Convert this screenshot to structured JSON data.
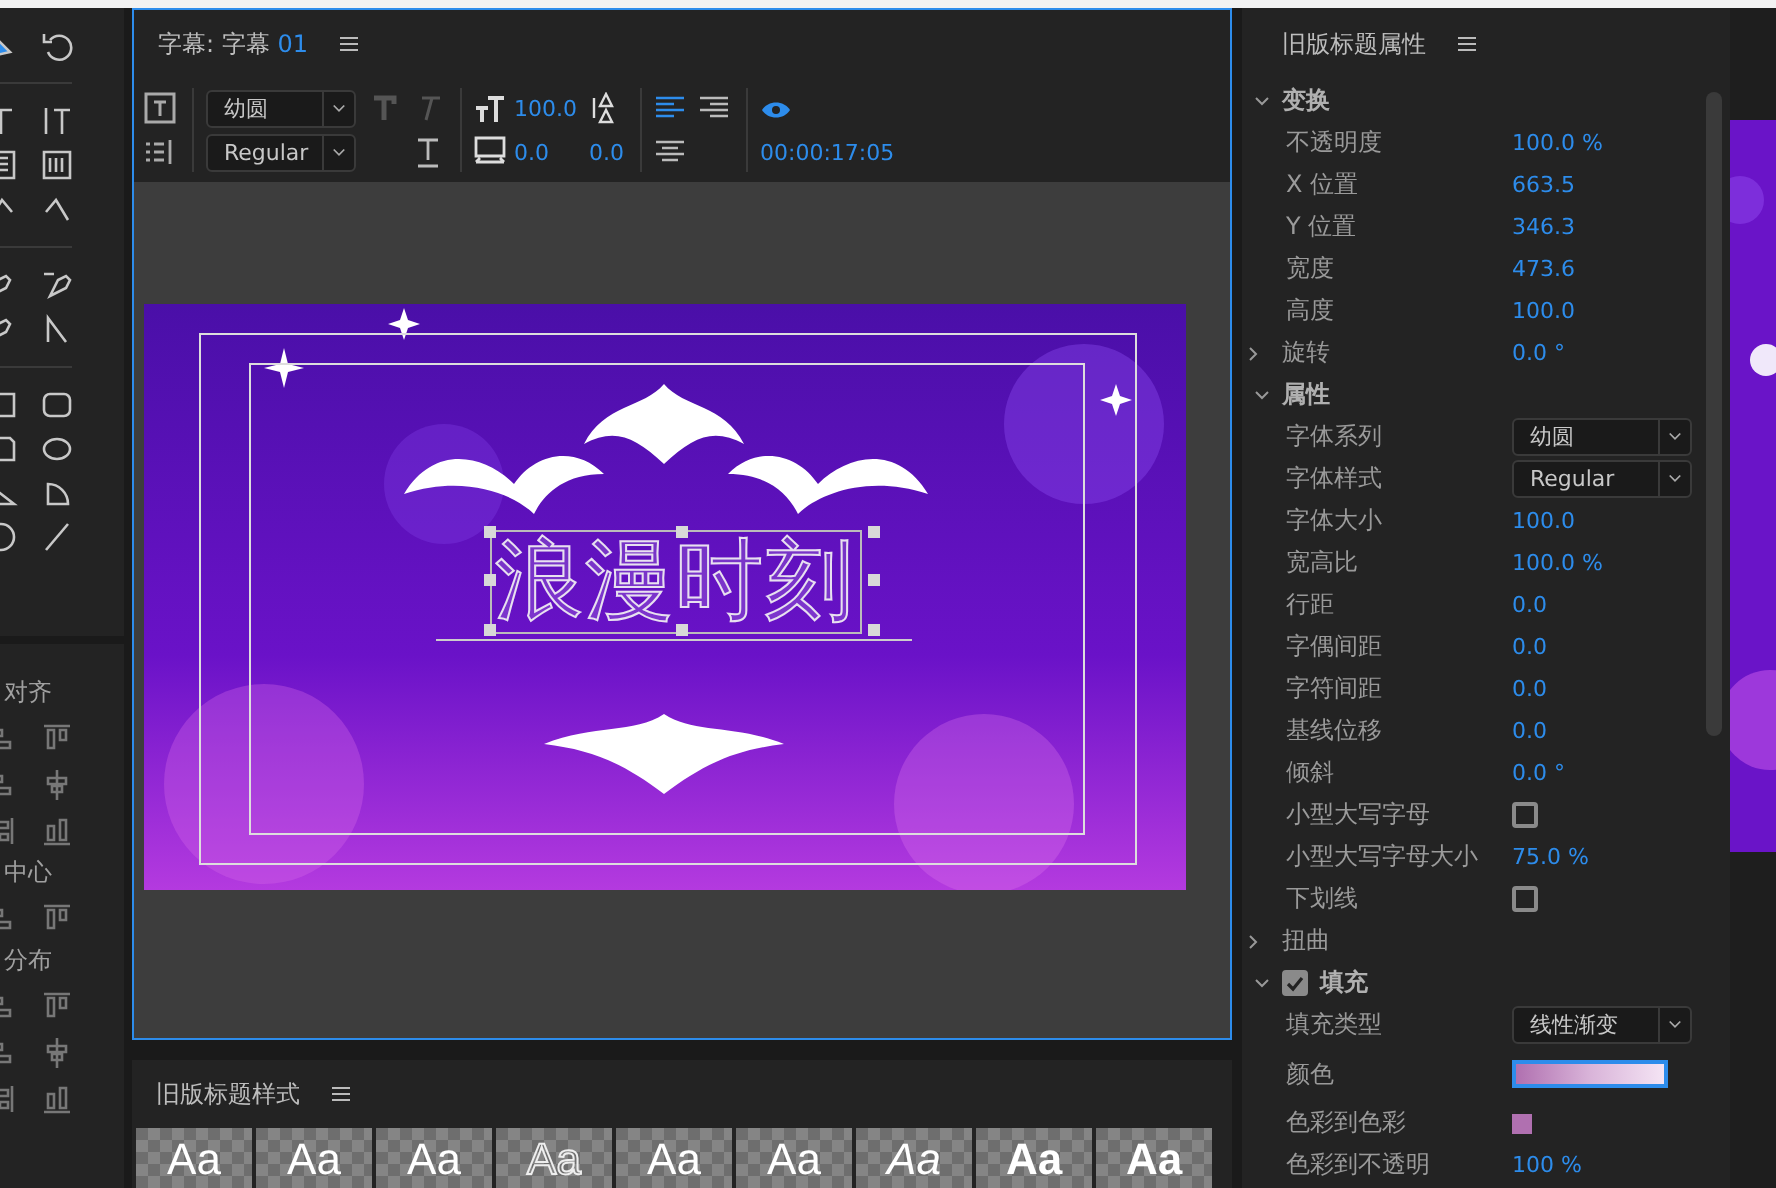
{
  "align_panel": {
    "sections": [
      {
        "title": "对齐"
      },
      {
        "title": "中心"
      },
      {
        "title": "分布"
      }
    ]
  },
  "title_panel": {
    "prefix": "字幕:",
    "name": "字幕",
    "number": "01",
    "toolbar": {
      "font_family": "幼圆",
      "font_style": "Regular",
      "font_size": "100.0",
      "kerning": "0.0",
      "leading": "0.0",
      "timecode": "00:00:17:05",
      "align": [
        {
          "kind": "left",
          "selected": true
        },
        {
          "kind": "center",
          "selected": false
        },
        {
          "kind": "right",
          "selected": false
        }
      ]
    },
    "canvas": {
      "title_text": "浪漫时刻"
    }
  },
  "styles_panel": {
    "title": "旧版标题样式",
    "styles": [
      {
        "label": "Aa",
        "kind": "regular"
      },
      {
        "label": "Aa",
        "kind": "regular"
      },
      {
        "label": "Aa",
        "kind": "regular"
      },
      {
        "label": "Aa",
        "kind": "outline"
      },
      {
        "label": "Aa",
        "kind": "regular"
      },
      {
        "label": "Aa",
        "kind": "regular"
      },
      {
        "label": "Aa",
        "kind": "italic"
      },
      {
        "label": "Aa",
        "kind": "bold"
      },
      {
        "label": "Aa",
        "kind": "bold"
      }
    ]
  },
  "properties_panel": {
    "title": "旧版标题属性",
    "sections": [
      {
        "title": "变换",
        "expanded": true,
        "rows": [
          {
            "kind": "value",
            "label": "不透明度",
            "value": "100.0 %"
          },
          {
            "kind": "value",
            "label": "X 位置",
            "value": "663.5"
          },
          {
            "kind": "value",
            "label": "Y 位置",
            "value": "346.3"
          },
          {
            "kind": "value",
            "label": "宽度",
            "value": "473.6"
          },
          {
            "kind": "value",
            "label": "高度",
            "value": "100.0"
          },
          {
            "kind": "group",
            "label": "旋转",
            "value": "0.0 °",
            "expanded": false
          }
        ]
      },
      {
        "title": "属性",
        "expanded": true,
        "rows": [
          {
            "kind": "dropdown",
            "label": "字体系列",
            "value": "幼圆"
          },
          {
            "kind": "dropdown",
            "label": "字体样式",
            "value": "Regular"
          },
          {
            "kind": "value",
            "label": "字体大小",
            "value": "100.0"
          },
          {
            "kind": "value",
            "label": "宽高比",
            "value": "100.0 %"
          },
          {
            "kind": "value",
            "label": "行距",
            "value": "0.0"
          },
          {
            "kind": "value",
            "label": "字偶间距",
            "value": "0.0"
          },
          {
            "kind": "value",
            "label": "字符间距",
            "value": "0.0"
          },
          {
            "kind": "value",
            "label": "基线位移",
            "value": "0.0"
          },
          {
            "kind": "value",
            "label": "倾斜",
            "value": "0.0 °"
          },
          {
            "kind": "checkbox",
            "label": "小型大写字母",
            "checked": false
          },
          {
            "kind": "value",
            "label": "小型大写字母大小",
            "value": "75.0 %"
          },
          {
            "kind": "checkbox",
            "label": "下划线",
            "checked": false
          },
          {
            "kind": "group",
            "label": "扭曲",
            "expanded": false
          }
        ]
      },
      {
        "title": "填充",
        "expanded": true,
        "checked": true,
        "rows": [
          {
            "kind": "dropdown",
            "label": "填充类型",
            "value": "线性渐变"
          },
          {
            "kind": "gradient",
            "label": "颜色"
          },
          {
            "kind": "swatch",
            "label": "色彩到色彩"
          },
          {
            "kind": "value",
            "label": "色彩到不透明",
            "value": "100 %"
          }
        ]
      }
    ]
  }
}
